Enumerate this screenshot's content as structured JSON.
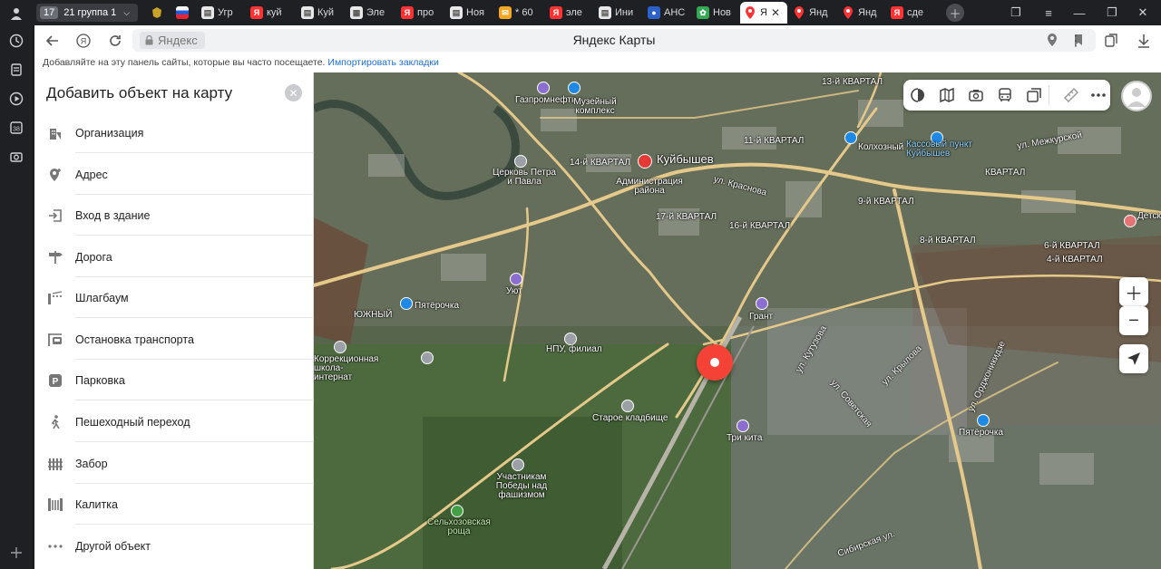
{
  "tabs": {
    "group_count": "17",
    "group_name": "21 группа 1",
    "items": [
      {
        "label": "Угр",
        "fav": "doc",
        "color": "#e8e8e8"
      },
      {
        "label": "куй",
        "fav": "Я",
        "color": "#f33"
      },
      {
        "label": "Куй",
        "fav": "doc",
        "color": "#e8e8e8"
      },
      {
        "label": "Эле",
        "fav": "grid",
        "color": "#e8e8e8"
      },
      {
        "label": "про",
        "fav": "Я",
        "color": "#f33"
      },
      {
        "label": "Ноя",
        "fav": "doc",
        "color": "#e8e8e8"
      },
      {
        "label": "* 60",
        "fav": "mail",
        "color": "#f5a623"
      },
      {
        "label": "эле",
        "fav": "Я",
        "color": "#f33"
      },
      {
        "label": "Ини",
        "fav": "doc",
        "color": "#e8e8e8"
      },
      {
        "label": "АНС",
        "fav": "round",
        "color": "#2a62c9"
      },
      {
        "label": "Нов",
        "fav": "multi",
        "color": "#34a853"
      },
      {
        "label": "Я",
        "fav": "pin",
        "color": "#f33"
      },
      {
        "label": "Янд",
        "fav": "pin",
        "color": "#f33"
      },
      {
        "label": "Янд",
        "fav": "pin",
        "color": "#f33"
      },
      {
        "label": "сде",
        "fav": "Я",
        "color": "#f33"
      }
    ]
  },
  "addressbar": {
    "domain": "Яндекс",
    "title": "Яндекс Карты"
  },
  "bookmarks": {
    "text": "Добавляйте на эту панель сайты, которые вы часто посещаете.",
    "link": "Импортировать закладки"
  },
  "panel": {
    "title": "Добавить объект на карту",
    "items": [
      {
        "label": "Организация",
        "icon": "building-icon"
      },
      {
        "label": "Адрес",
        "icon": "address-pin-icon"
      },
      {
        "label": "Вход в здание",
        "icon": "entrance-icon"
      },
      {
        "label": "Дорога",
        "icon": "road-sign-icon"
      },
      {
        "label": "Шлагбаум",
        "icon": "barrier-icon"
      },
      {
        "label": "Остановка транспорта",
        "icon": "bus-stop-icon"
      },
      {
        "label": "Парковка",
        "icon": "parking-icon"
      },
      {
        "label": "Пешеходный переход",
        "icon": "pedestrian-icon"
      },
      {
        "label": "Забор",
        "icon": "fence-icon"
      },
      {
        "label": "Калитка",
        "icon": "gate-icon"
      },
      {
        "label": "Другой объект",
        "icon": "more-dots-icon"
      }
    ]
  },
  "map": {
    "labels": [
      "Газпромнефть",
      "Музейный комплекс",
      "Церковь Петра и Павла",
      "14-й КВАРТАЛ",
      "Куйбышев",
      "Администрация района",
      "ул. Краснова",
      "11-й КВАРТАЛ",
      "13-й КВАРТАЛ",
      "Колхозный",
      "Кассовый пункт Куйбышев",
      "ул. Межкурской",
      "КВАРТАЛ",
      "Детская поликлиника",
      "17-й КВАРТАЛ",
      "16-й КВАРТАЛ",
      "9-й КВАРТАЛ",
      "8-й КВАРТАЛ",
      "6-й КВАРТАЛ",
      "4-й КВАРТАЛ",
      "Уют",
      "Пятёрочка",
      "ЮЖНЫЙ",
      "Грант",
      "Коррекционная школа-интернат",
      "НПУ, филиал",
      "Старое кладбище",
      "Три кита",
      "Участникам Победы над фашизмом",
      "Сельхозовская роща",
      "Пятёрочка",
      "ул. Кутузова",
      "ул. Орджоникидзе",
      "ул. Крылова",
      "ул. Советская",
      "Сибирская ул."
    ]
  }
}
